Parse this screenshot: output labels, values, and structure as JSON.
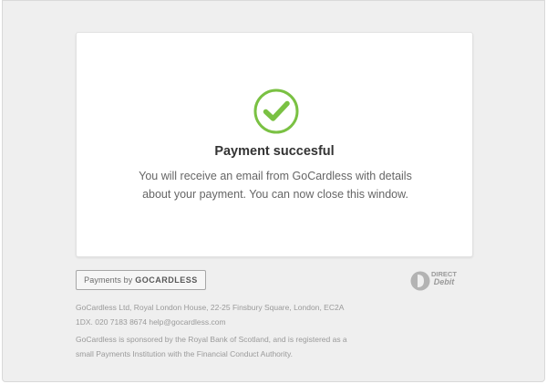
{
  "status": {
    "title": "Payment succesful",
    "message": "You will receive an email from GoCardless with details about your payment. You can now close this window."
  },
  "badge": {
    "prefix": "Payments by",
    "brand": "GOCARDLESS"
  },
  "direct_debit": {
    "line1": "DIRECT",
    "line2": "Debit"
  },
  "footer": {
    "address": "GoCardless Ltd, Royal London House, 22-25 Finsbury Square, London, EC2A 1DX. 020 7183 8674  help@gocardless.com",
    "sponsor": "GoCardless is sponsored by the Royal Bank of Scotland, and is registered as a small Payments Institution with the Financial Conduct Authority."
  },
  "colors": {
    "success_green": "#7ac143",
    "background": "#efefef",
    "card": "#ffffff"
  },
  "icons": {
    "success": "checkmark-circle-icon",
    "direct_debit": "direct-debit-logo"
  }
}
